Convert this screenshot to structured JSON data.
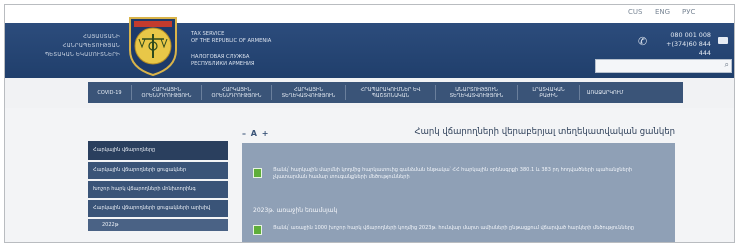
{
  "lang": {
    "items": [
      "CUS",
      "ENG",
      "РУС"
    ]
  },
  "header": {
    "arm_lines": [
      "ՀԱՅԱՍՏԱՆԻ",
      "ՀԱՆՐԱՊԵՏՈՒԹՅԱՆ",
      "ՊԵՏԱԿԱՆ ԵԿԱՄՈՒՏՆԵՐԻ"
    ],
    "en_lines": [
      "TAX SERVICE",
      "OF THE REPUBLIC OF ARMENIA"
    ],
    "ru_lines": [
      "НАЛОГОВАЯ СЛУЖБА",
      "РЕСПУБЛИКИ АРМЕНИЯ"
    ],
    "phone1": "080 001 008",
    "phone2": "+(374)60 844 444",
    "search_placeholder": ""
  },
  "nav": {
    "items": [
      "COVID-19",
      "ՀԱՐԿԱՅԻՆ ՕՐԵՆՍԴՐՈՒԹՅՈՒՆ",
      "ՀԱՐԿԱՅԻՆ ՕՐԵՆՍԴՐՈՒԹՅՈՒՆ",
      "ՀԱՐԿԱՅԻՆ ՏԵՂԵԿԱՏՎՈՒԹՅՈՒՆ",
      "ՀՐԱՊԱՐԱԿՈՒՄՆԵՐ ԵՎ ՊԱՇՏՈՆԱԿԱՆ",
      "ԱՆԱՐՏՈՒԹՅՈՒՆ ՏԵՂԵԿԱՏՎՈՒԹՅՈՒՆ",
      "ԼՐԱՏՎԱԿԱՆ ԲԱԺԻՆ",
      "ԱՌԱՋԱՐԿՈՒՄ"
    ]
  },
  "sidebar": {
    "items": [
      "Հարկային վճարողները",
      "Հարկային վճարողների ցուցակներ",
      "Խոշոր հարկ վճարողների մոնիտորինգ",
      "Հարկային վճարողների ցուցակների արխիվ"
    ],
    "sub_item": "2022թ"
  },
  "main": {
    "font_controls": "– A +",
    "title": "Հարկ վճարողների վերաբերյալ տեղեկատվական ցանկեր",
    "row1": "Ցանկ՝ հարկային մարմնի կողմից հարկատուից գանձման ենթակա՝ ՀՀ հարկային օրենսգրքի 380.1 և 383 րդ հոդվածների պահանջների չկատարման համար տուգանքների մեծությունների",
    "year_heading": "2023թ. առաջին եռամսյակ",
    "row2": "Ցանկ՝ առաջին 1000 խոշոր հարկ վճարողների կողմից 2023թ. հունվար մարտ ամիսների ընթացքում վճարված հարկերի մեծությունները"
  }
}
